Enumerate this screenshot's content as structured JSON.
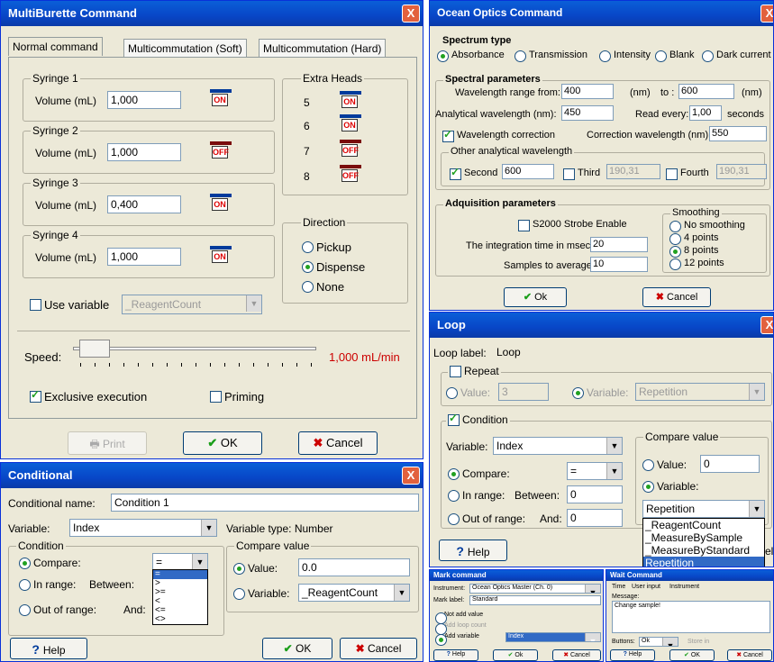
{
  "multiburette": {
    "title": "MultiBurette Command",
    "close": "X",
    "tabs": [
      "Normal command",
      "Multicommutation (Soft)",
      "Multicommutation (Hard)"
    ],
    "syringes": [
      {
        "label": "Syringe 1",
        "vol_label": "Volume (mL)",
        "value": "1,000",
        "state": "ON"
      },
      {
        "label": "Syringe 2",
        "vol_label": "Volume (mL)",
        "value": "1,000",
        "state": "OFF"
      },
      {
        "label": "Syringe 3",
        "vol_label": "Volume (mL)",
        "value": "0,400",
        "state": "ON"
      },
      {
        "label": "Syringe 4",
        "vol_label": "Volume (mL)",
        "value": "1,000",
        "state": "ON"
      }
    ],
    "extra_heads": {
      "title": "Extra Heads",
      "items": [
        {
          "n": "5",
          "state": "ON"
        },
        {
          "n": "6",
          "state": "ON"
        },
        {
          "n": "7",
          "state": "OFF"
        },
        {
          "n": "8",
          "state": "OFF"
        }
      ]
    },
    "direction": {
      "title": "Direction",
      "options": [
        "Pickup",
        "Dispense",
        "None"
      ],
      "selected": "Dispense"
    },
    "use_variable": "Use variable",
    "use_variable_value": "_ReagentCount",
    "speed_label": "Speed:",
    "speed_value": "1,000 mL/min",
    "speed_level": 0.1,
    "exclusive": "Exclusive execution",
    "priming": "Priming",
    "print": "Print",
    "ok": "OK",
    "cancel": "Cancel"
  },
  "ocean": {
    "title": "Ocean Optics Command",
    "close": "X",
    "spectrum_type": "Spectrum type",
    "types": [
      "Absorbance",
      "Transmission",
      "Intensity",
      "Blank",
      "Dark current"
    ],
    "spectral_params": "Spectral parameters",
    "wl_from": "Wavelength range from:",
    "wl_from_val": "400",
    "nm1": "(nm)",
    "to": "to :",
    "wl_to_val": "600",
    "nm2": "(nm)",
    "analytical": "Analytical wavelength (nm):",
    "analytical_val": "450",
    "read_every": "Read every:",
    "read_every_val": "1,00",
    "seconds": "seconds",
    "wl_corr": "Wavelength correction",
    "corr_wl": "Correction wavelength (nm):",
    "corr_wl_val": "550",
    "other_analytical": "Other analytical wavelength",
    "second": "Second",
    "second_val": "600",
    "third": "Third",
    "third_val": "190,31",
    "fourth": "Fourth",
    "fourth_val": "190,31",
    "acq_params": "Adquisition parameters",
    "strobe": "S2000 Strobe Enable",
    "integration": "The integration time in msec.:",
    "integration_val": "20",
    "samples": "Samples to average:",
    "samples_val": "10",
    "smoothing": "Smoothing",
    "smooth_opts": [
      "No smoothing",
      "4 points",
      "8 points",
      "12 points"
    ],
    "smooth_sel": "8 points",
    "ok": "Ok",
    "cancel": "Cancel"
  },
  "loop": {
    "title": "Loop",
    "close": "X",
    "label_label": "Loop label:",
    "label_val": "Loop",
    "repeat": "Repeat",
    "value_label": "Value:",
    "value_val": "3",
    "variable_label": "Variable:",
    "variable_val": "Repetition",
    "condition": "Condition",
    "cond_var_label": "Variable:",
    "cond_var_val": "Index",
    "compare": "Compare:",
    "compare_op": "=",
    "in_range": "In range:",
    "between": "Between:",
    "between_val": "0",
    "out_range": "Out of range:",
    "and": "And:",
    "and_val": "0",
    "compare_value": "Compare value",
    "cv_value": "Value:",
    "cv_value_val": "0",
    "cv_variable": "Variable:",
    "cv_variable_val": "Repetition",
    "dropdown": [
      "_ReagentCount",
      "_MeasureBySample",
      "_MeasureByStandard",
      "Repetition"
    ],
    "help": "Help",
    "cancel_tail": "el"
  },
  "conditional": {
    "title": "Conditional",
    "close": "X",
    "name_label": "Conditional name:",
    "name_val": "Condition 1",
    "var_label": "Variable:",
    "var_val": "Index",
    "var_type": "Variable type: Number",
    "condition": "Condition",
    "compare": "Compare:",
    "compare_op": "=",
    "in_range": "In range:",
    "between": "Between:",
    "out_range": "Out of range:",
    "and": "And:",
    "ops": [
      "=",
      ">",
      ">=",
      "<",
      "<=",
      "<>"
    ],
    "compare_value": "Compare value",
    "cv_value": "Value:",
    "cv_value_val": "0.0",
    "cv_variable": "Variable:",
    "cv_variable_val": "_ReagentCount",
    "help": "Help",
    "ok": "OK",
    "cancel": "Cancel"
  },
  "mark": {
    "title": "Mark command",
    "instrument_label": "Instrument:",
    "instrument_val": "Ocean Optics Master (Ch. 0)",
    "mark_label": "Mark label:",
    "mark_val": "Standard",
    "opts": [
      "Not add value",
      "Add loop count",
      "Add variable"
    ],
    "var_val": "Index",
    "help": "Help",
    "ok": "Ok",
    "cancel": "Cancel"
  },
  "wait": {
    "title": "Wait Command",
    "tabs": [
      "Time",
      "User input",
      "Instrument"
    ],
    "message": "Message:",
    "message_val": "Change sample!",
    "buttons": "Buttons:",
    "buttons_val": "Ok",
    "store": "Store in",
    "help": "Help",
    "ok": "OK",
    "cancel": "Cancel"
  }
}
